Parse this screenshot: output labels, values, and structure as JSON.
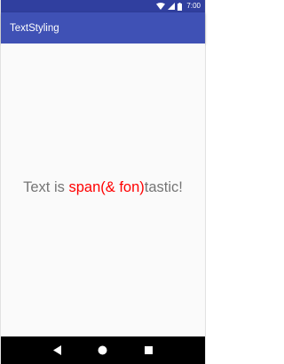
{
  "status_bar": {
    "time": "7:00",
    "icons": [
      "wifi-icon",
      "signal-icon",
      "battery-icon"
    ]
  },
  "app_bar": {
    "title": "TextStyling"
  },
  "content": {
    "text_prefix": "Text is ",
    "text_styled": "span(& fon)",
    "text_suffix": "tastic!"
  },
  "nav_bar": {
    "buttons": [
      "back-icon",
      "home-icon",
      "recents-icon"
    ]
  },
  "colors": {
    "status_bar": "#303f9f",
    "app_bar": "#3f51b5",
    "text_gray": "#757575",
    "text_styled": "#ff0000"
  }
}
